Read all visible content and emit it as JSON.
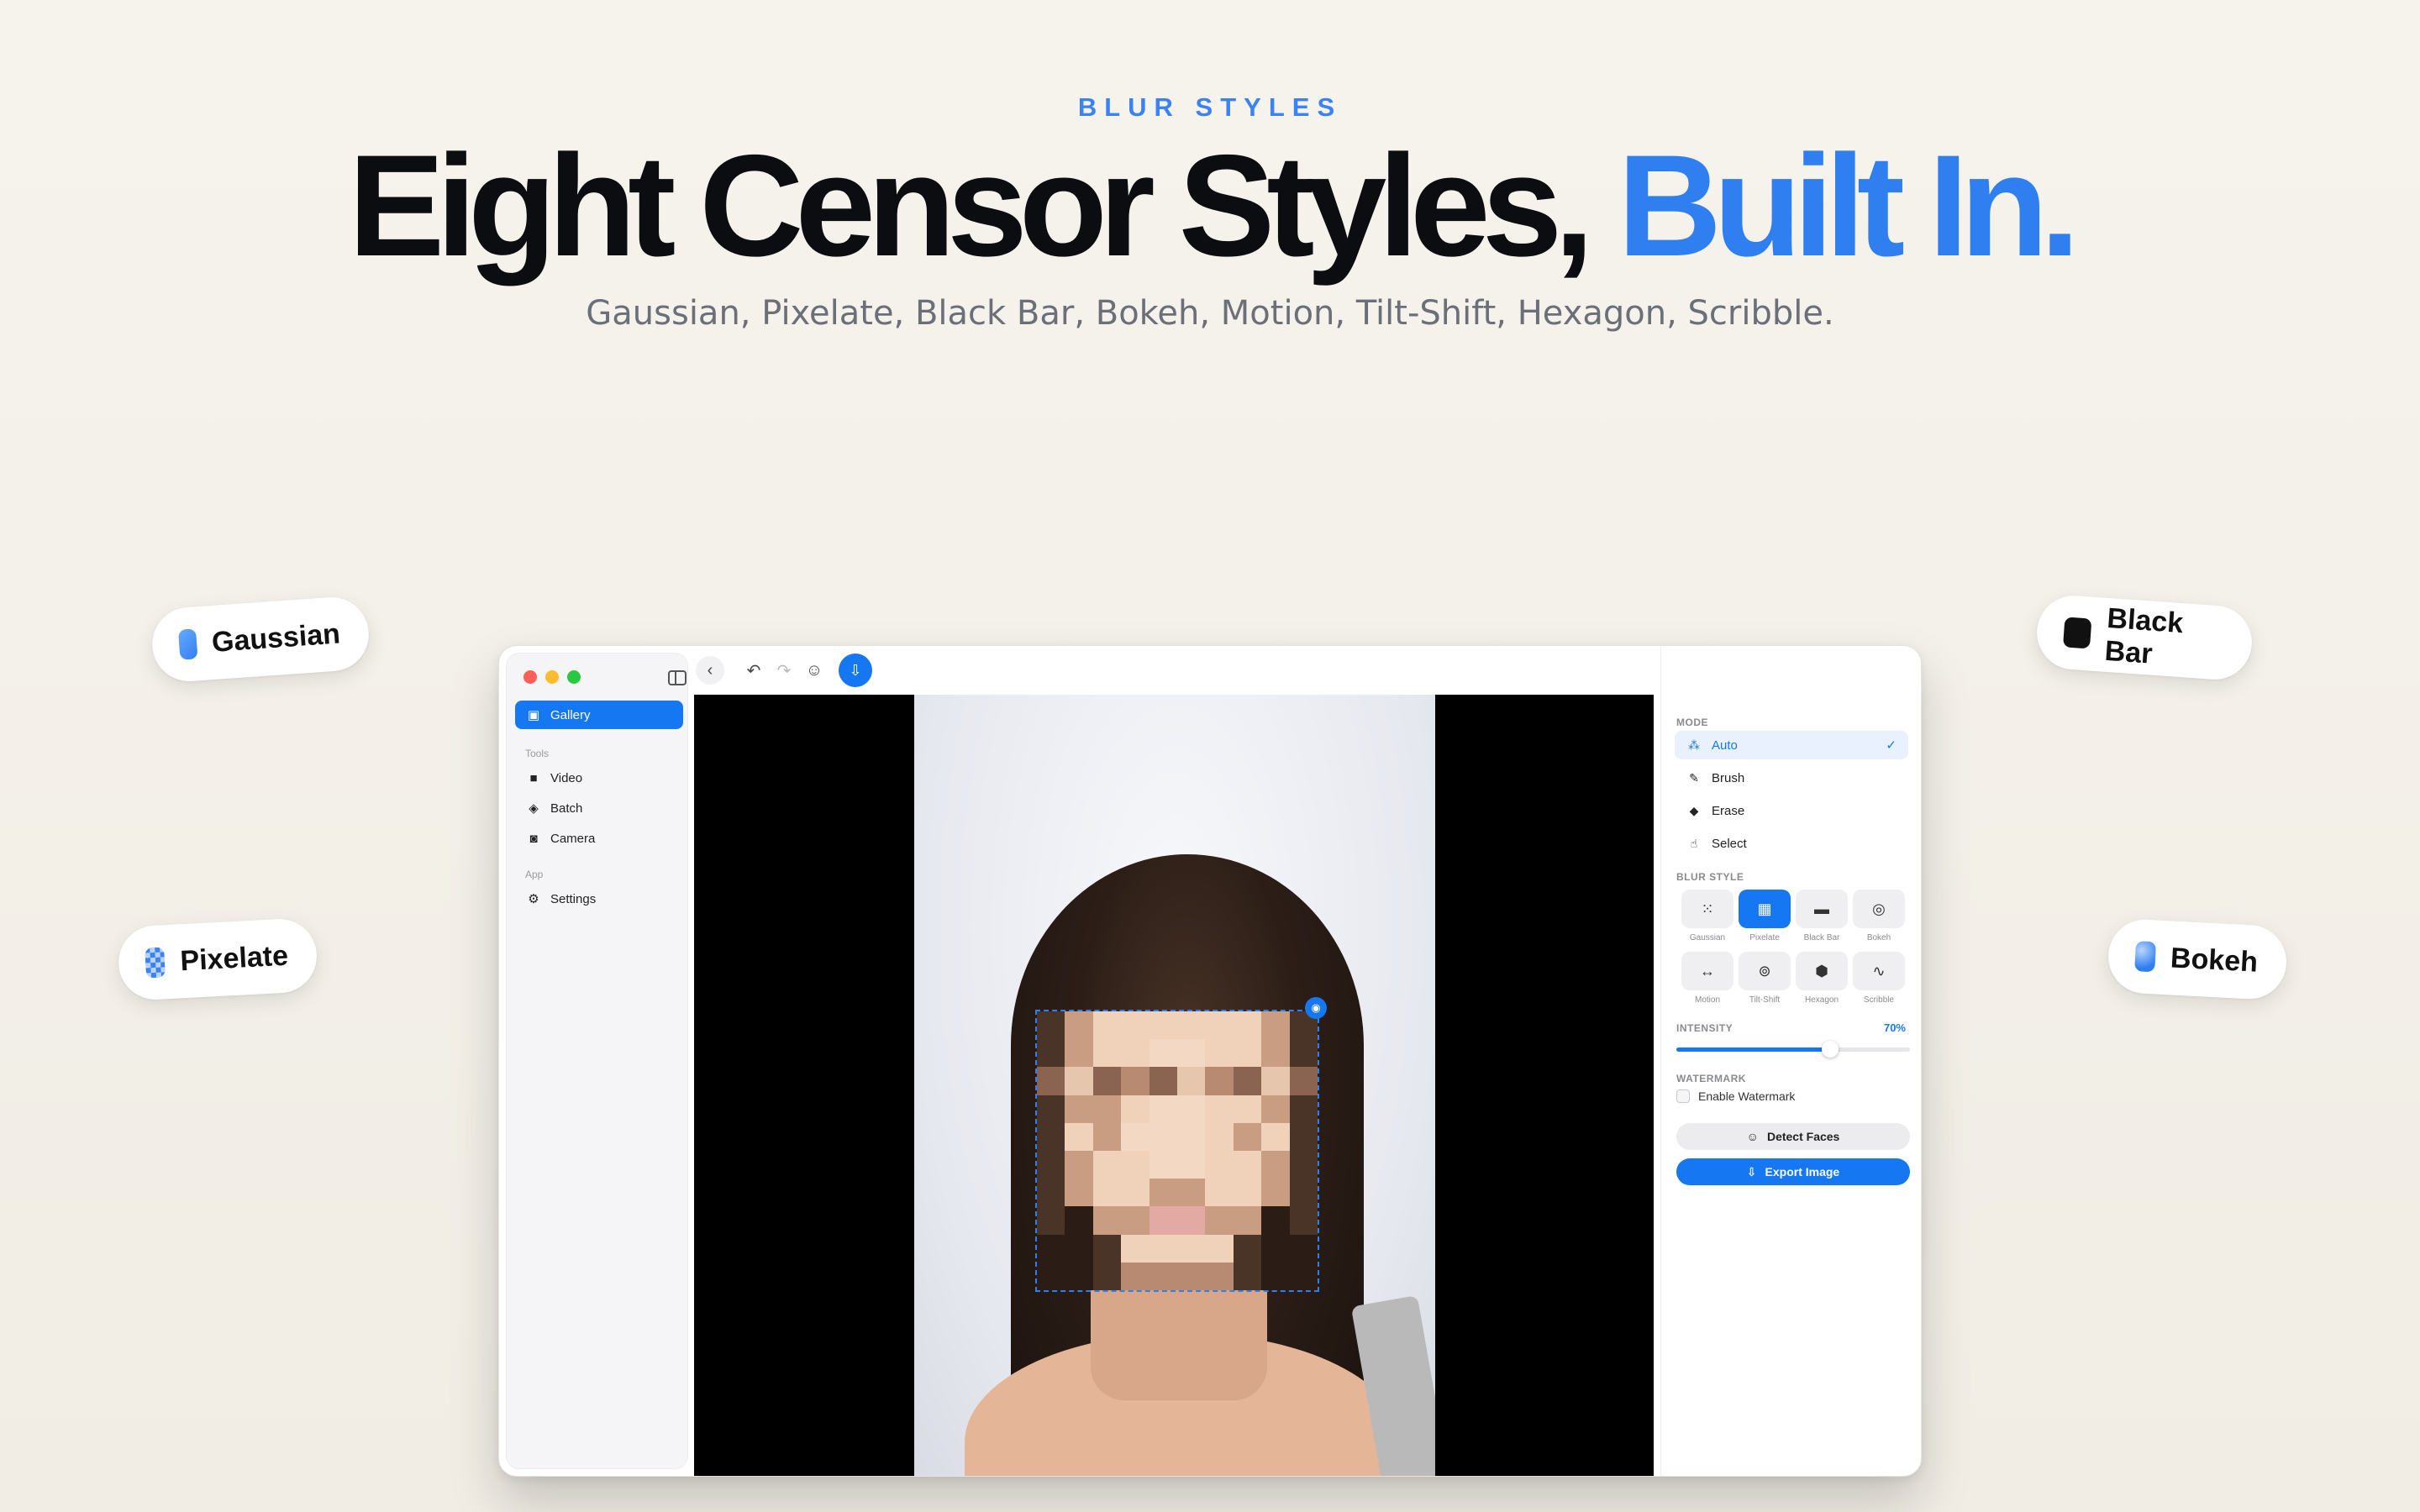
{
  "hero": {
    "eyebrow": "BLUR STYLES",
    "headline_main": "Eight Censor Styles,",
    "headline_accent": "Built In.",
    "subline": "Gaussian, Pixelate, Black Bar, Bokeh, Motion, Tilt-Shift, Hexagon, Scribble."
  },
  "pills": {
    "gaussian": "Gaussian",
    "pixelate": "Pixelate",
    "black_bar": "Black Bar",
    "bokeh": "Bokeh"
  },
  "sidebar": {
    "gallery": "Gallery",
    "tools_section": "Tools",
    "video": "Video",
    "batch": "Batch",
    "camera": "Camera",
    "app_section": "App",
    "settings": "Settings"
  },
  "panel": {
    "mode_label": "MODE",
    "modes": [
      "Auto",
      "Brush",
      "Erase",
      "Select"
    ],
    "selected_mode": "Auto",
    "blur_style_label": "BLUR STYLE",
    "styles": [
      "Gaussian",
      "Pixelate",
      "Black Bar",
      "Bokeh",
      "Motion",
      "Tilt-Shift",
      "Hexagon",
      "Scribble"
    ],
    "selected_style": "Pixelate",
    "intensity_label": "INTENSITY",
    "intensity_value": "70%",
    "intensity": 0.66,
    "watermark_label": "WATERMARK",
    "enable_watermark": "Enable Watermark",
    "watermark_enabled": false,
    "detect_faces": "Detect Faces",
    "export_image": "Export Image"
  },
  "colors": {
    "accent": "#1677f2",
    "headline_accent": "#2f7ff0"
  }
}
